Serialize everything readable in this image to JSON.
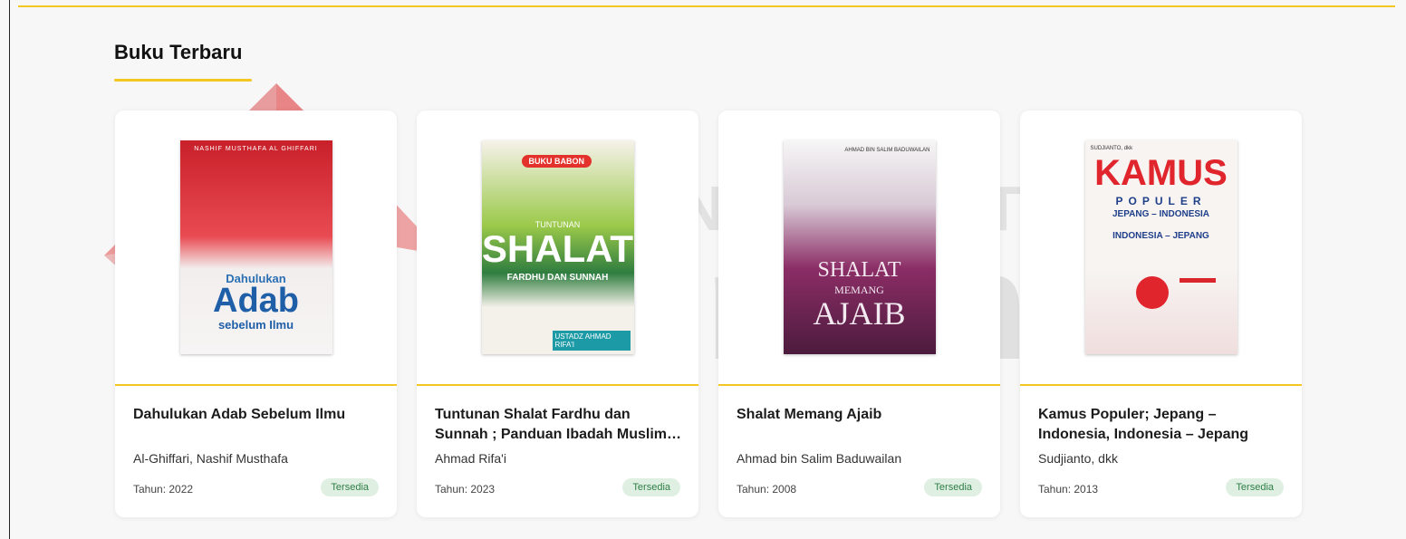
{
  "section": {
    "title": "Buku Terbaru"
  },
  "watermark": {
    "line1": "UNIVERSITAS",
    "line2": "Dinamika"
  },
  "books": [
    {
      "title": "Dahulukan Adab Sebelum Ilmu",
      "author": "Al-Ghiffari, Nashif Musthafa",
      "year": "Tahun: 2022",
      "status": "Tersedia",
      "cover": {
        "top_text": "NASHIF MUSTHAFA AL GHIFFARI",
        "big": "Adab",
        "sub1": "Dahulukan",
        "sub2": "sebelum Ilmu"
      }
    },
    {
      "title": "Tuntunan Shalat Fardhu dan Sunnah ; Panduan Ibadah Muslim Sesuai Teladan Rasulullah SAW",
      "author": "Ahmad Rifa'i",
      "year": "Tahun: 2023",
      "status": "Tersedia",
      "cover": {
        "top_text": "BUKU BABON",
        "big": "SHALAT",
        "sub1": "TUNTUNAN",
        "sub2": "FARDHU DAN SUNNAH",
        "footer": "USTADZ AHMAD RIFA'I"
      }
    },
    {
      "title": "Shalat Memang Ajaib",
      "author": "Ahmad bin Salim Baduwailan",
      "year": "Tahun: 2008",
      "status": "Tersedia",
      "cover": {
        "top_text": "AHMAD BIN SALIM BADUWAILAN",
        "big": "AJAIB",
        "sub1": "SHALAT",
        "sub2": "MEMANG"
      }
    },
    {
      "title": "Kamus Populer; Jepang – Indonesia, Indonesia – Jepang",
      "author": "Sudjianto, dkk",
      "year": "Tahun: 2013",
      "status": "Tersedia",
      "cover": {
        "top_text": "SUDJIANTO, dkk",
        "big": "KAMUS",
        "sub1": "POPULER",
        "sub2": "JEPANG – INDONESIA",
        "sub3": "INDONESIA – JEPANG"
      }
    }
  ],
  "colors": {
    "accent": "#f3c623",
    "badge_bg": "#dff0e3",
    "badge_text": "#2e7d45"
  }
}
